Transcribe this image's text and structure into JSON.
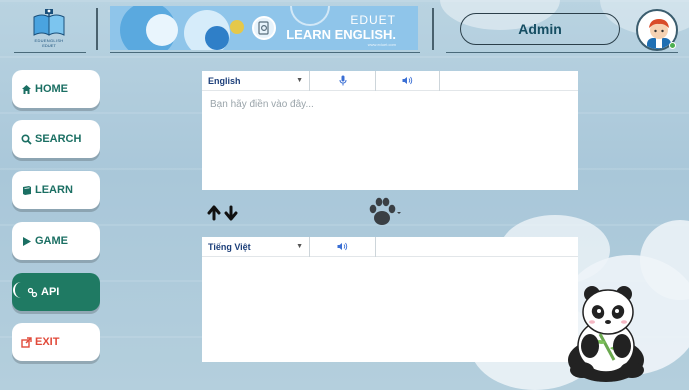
{
  "app": {
    "logo_text": "EDUENGLISH",
    "logo_sub": "EDUET",
    "banner": {
      "line1": "EDUET",
      "line2": "LEARN ENGLISH.",
      "line3": "www.eduet.com"
    },
    "user": "Admin"
  },
  "sidebar": {
    "items": [
      {
        "label": "HOME",
        "icon": "home-icon"
      },
      {
        "label": "SEARCH",
        "icon": "search-icon"
      },
      {
        "label": "LEARN",
        "icon": "book-icon"
      },
      {
        "label": "GAME",
        "icon": "play-icon"
      },
      {
        "label": "API",
        "icon": "link-icon"
      },
      {
        "label": "EXIT",
        "icon": "external-link-icon"
      }
    ],
    "active": "API"
  },
  "translator": {
    "source": {
      "language": "English",
      "placeholder": "Bạn hãy điền vào đây...",
      "value": ""
    },
    "target": {
      "language": "Tiếng Việt",
      "value": ""
    }
  },
  "colors": {
    "nav_text": "#1b6f63",
    "nav_active_bg": "#1f7a63",
    "exit_text": "#e14a3a",
    "admin_text": "#164e63",
    "language_text": "#1c3f7a"
  }
}
